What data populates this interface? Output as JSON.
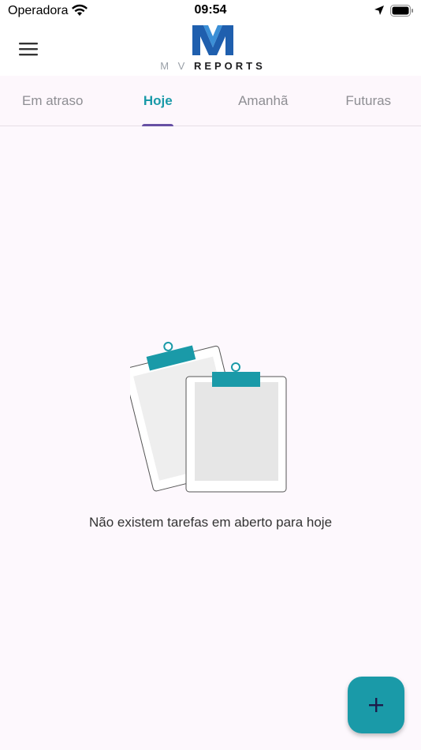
{
  "status_bar": {
    "carrier": "Operadora",
    "time": "09:54"
  },
  "app": {
    "logo": {
      "prefix": "M V",
      "name": "REPORTS"
    },
    "icons": {
      "menu": "hamburger-menu-icon",
      "fab": "plus-icon"
    }
  },
  "tabs": [
    {
      "label": "Em atraso",
      "active": false
    },
    {
      "label": "Hoje",
      "active": true
    },
    {
      "label": "Amanhã",
      "active": false
    },
    {
      "label": "Futuras",
      "active": false
    }
  ],
  "empty_state": {
    "message": "Não existem tarefas em aberto para hoje"
  },
  "colors": {
    "accent": "#1a9aa8",
    "indicator": "#6750a4",
    "logo_blue": "#1f5fae",
    "background": "#fdf8fd"
  }
}
